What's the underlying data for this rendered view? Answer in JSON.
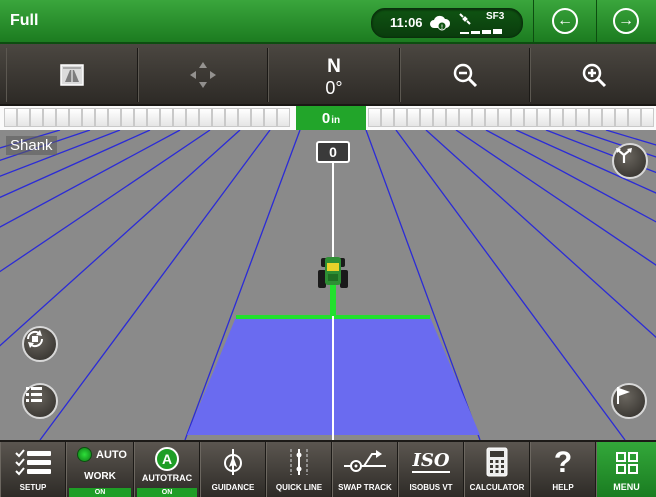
{
  "title_bar": {
    "title": "Full",
    "time": "11:06",
    "signal_label": "SF3",
    "signal_level_bars": 4
  },
  "toolbar": {
    "heading_letter": "N",
    "heading_value": "0°"
  },
  "light_bar": {
    "offset_value": "0",
    "offset_unit": "in"
  },
  "field": {
    "implement_label": "Shank",
    "track_number": "0"
  },
  "bottom_bar": {
    "setup": "SETUP",
    "work_status": "AUTO",
    "work": "WORK",
    "work_state": "ON",
    "autotrac_letter": "A",
    "autotrac": "AUTOTRAC",
    "autotrac_state": "ON",
    "guidance": "GUIDANCE",
    "quick_line": "QUICK LINE",
    "swap_track": "SWAP TRACK",
    "iso_logo": "ISO",
    "isobus_vt": "ISOBUS VT",
    "calculator": "CALCULATOR",
    "help_symbol": "?",
    "help": "HELP",
    "menu": "MENU"
  },
  "colors": {
    "brand_green": "#1f8a24",
    "coverage": "#6a6bf0",
    "guidance_line": "#2b2bd6",
    "field_gray": "#8a8a8a"
  }
}
